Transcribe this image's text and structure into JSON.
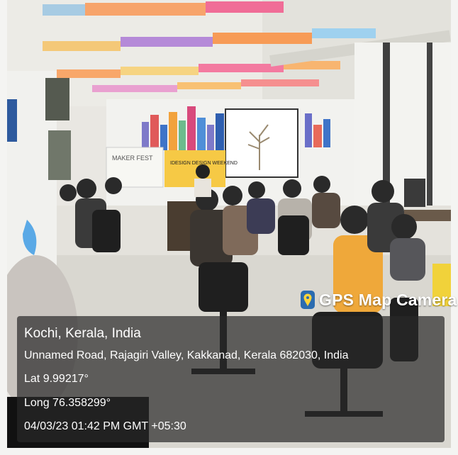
{
  "photo": {
    "banner_text": "MAKER FEST",
    "poster_text": "IDESIGN DESIGN WEEKEND"
  },
  "stamp": {
    "brand": "GPS Map Camera",
    "brand_icon": "map-pin-icon",
    "city": "Kochi, Kerala, India",
    "address": "Unnamed Road, Rajagiri Valley, Kakkanad, Kerala 682030, India",
    "lat": "Lat 9.99217°",
    "long": "Long 76.358299°",
    "datetime": "04/03/23 01:42 PM GMT +05:30"
  }
}
